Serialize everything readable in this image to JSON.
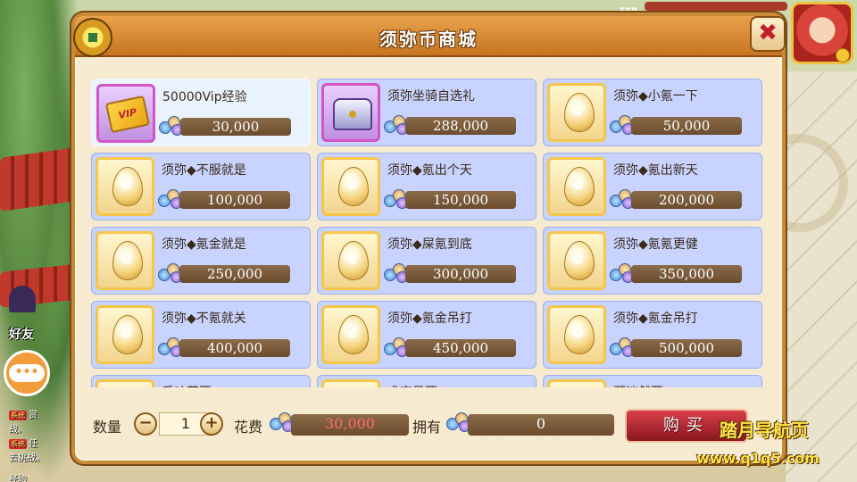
{
  "window": {
    "title": "须弥币商城",
    "close_label": "✖"
  },
  "hud": {
    "exp_label": "EXP"
  },
  "items": [
    {
      "name": "50000Vip经验",
      "price": "30,000",
      "icon": "vip-card-icon",
      "selected": true
    },
    {
      "name": "须弥坐骑自选礼",
      "price": "288,000",
      "icon": "treasure-chest-icon"
    },
    {
      "name": "须弥◆小氪一下",
      "price": "50,000",
      "icon": "egg-icon"
    },
    {
      "name": "须弥◆不服就是",
      "price": "100,000",
      "icon": "egg-icon"
    },
    {
      "name": "须弥◆氪出个天",
      "price": "150,000",
      "icon": "egg-icon"
    },
    {
      "name": "须弥◆氪出新天",
      "price": "200,000",
      "icon": "egg-icon"
    },
    {
      "name": "须弥◆氪金就是",
      "price": "250,000",
      "icon": "egg-icon"
    },
    {
      "name": "须弥◆屎氪到底",
      "price": "300,000",
      "icon": "egg-icon"
    },
    {
      "name": "须弥◆氪氪更健",
      "price": "350,000",
      "icon": "egg-icon"
    },
    {
      "name": "须弥◆不氪就关",
      "price": "400,000",
      "icon": "egg-icon"
    },
    {
      "name": "须弥◆氪金吊打",
      "price": "450,000",
      "icon": "egg-icon"
    },
    {
      "name": "须弥◆氪金吊打",
      "price": "500,000",
      "icon": "egg-icon"
    },
    {
      "name": "乐叶草要",
      "price": "",
      "icon": "egg-icon"
    },
    {
      "name": "术育员要",
      "price": "",
      "icon": "egg-icon"
    },
    {
      "name": "预淡然要",
      "price": "",
      "icon": "egg-icon"
    }
  ],
  "bottom": {
    "qty_label": "数量",
    "minus": "−",
    "quantity": "1",
    "plus": "+",
    "cost_label": "花费",
    "cost_value": "30,000",
    "own_label": "拥有",
    "own_value": "0",
    "buy_label": "购买"
  },
  "side": {
    "friend_label": "好友",
    "chat_icon": "•••",
    "chat_lines": [
      {
        "tag": "系统",
        "text": "赏"
      },
      {
        "tag": "",
        "text": "战。"
      },
      {
        "tag": "系统",
        "text": "任"
      },
      {
        "tag": "",
        "text": "去挑战。"
      },
      {
        "tag": "",
        "text": "经验"
      }
    ]
  },
  "watermark": {
    "line1": "踏月导航页",
    "line2": "www.q1q5.com"
  },
  "colors": {
    "accent": "#c77421",
    "item_bg": "#c8d3ff",
    "buy": "#b02a32",
    "cost_text": "#ff6a6a"
  }
}
